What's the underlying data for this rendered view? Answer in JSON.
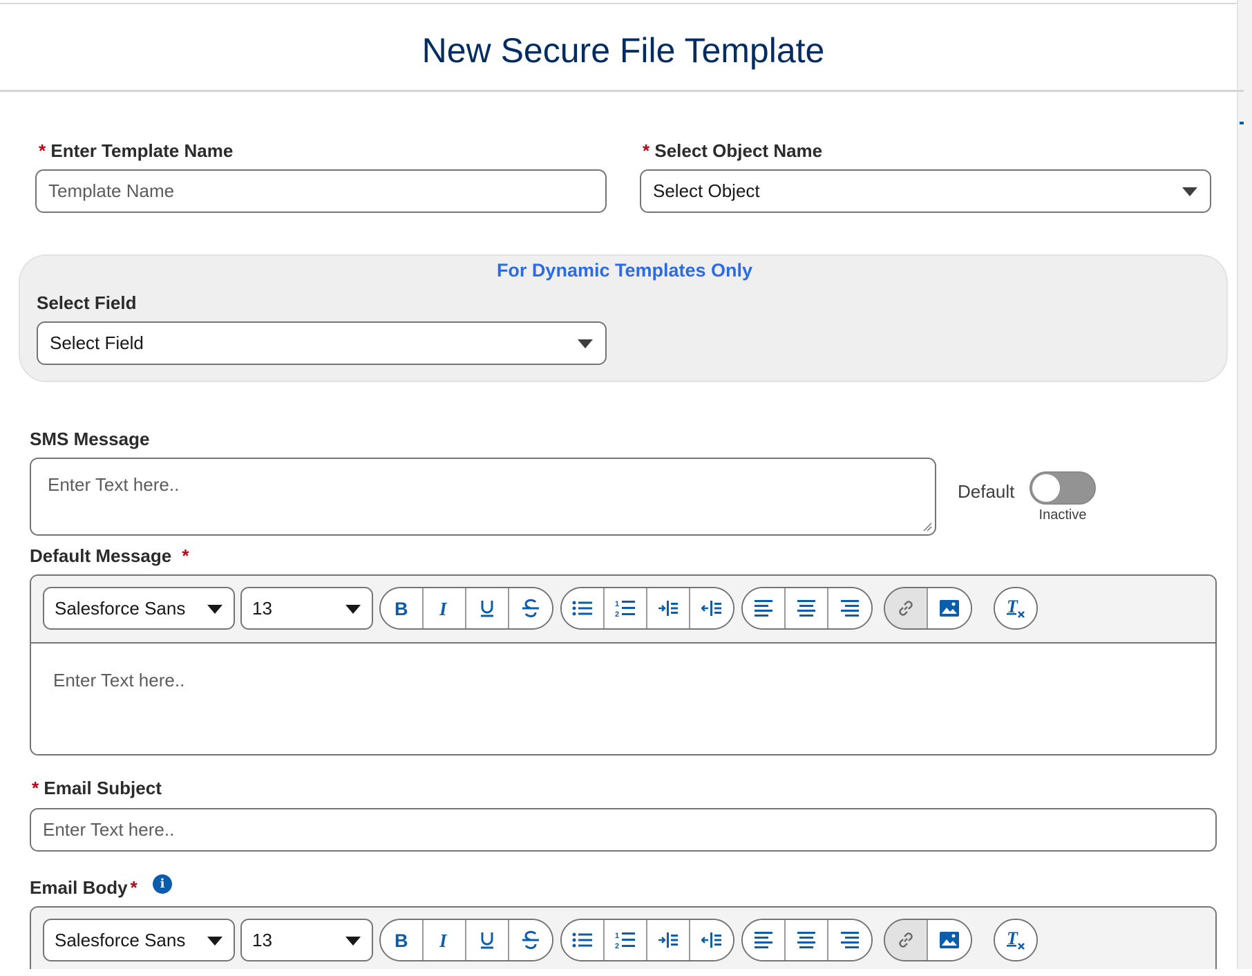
{
  "header": {
    "title": "New Secure File Template"
  },
  "form": {
    "required_mark": "*",
    "template_name": {
      "label": "Enter Template Name",
      "placeholder": "Template Name"
    },
    "object_name": {
      "label": "Select Object Name",
      "selected": "Select Object"
    },
    "dynamic": {
      "title": "For Dynamic Templates Only",
      "field_label": "Select Field",
      "field_selected": "Select Field"
    },
    "sms": {
      "label": "SMS Message",
      "placeholder": "Enter Text here..",
      "toggle_label": "Default",
      "toggle_state": "Inactive"
    },
    "default_message": {
      "label": "Default Message",
      "font": "Salesforce Sans",
      "size": "13",
      "placeholder": "Enter Text here.."
    },
    "email_subject": {
      "label": "Email Subject",
      "placeholder": "Enter Text here.."
    },
    "email_body": {
      "label": "Email Body",
      "info_glyph": "i",
      "font": "Salesforce Sans",
      "size": "13"
    }
  },
  "toolbar_icons": [
    "bold-icon",
    "italic-icon",
    "underline-icon",
    "strikethrough-icon",
    "bullet-list-icon",
    "numbered-list-icon",
    "indent-icon",
    "outdent-icon",
    "align-left-icon",
    "align-center-icon",
    "align-right-icon",
    "link-icon",
    "image-icon",
    "clear-formatting-icon"
  ],
  "colors": {
    "title": "#032d60",
    "required": "#ba0517",
    "dynamic_title": "#2c6be3",
    "icon_blue": "#0b5cab",
    "toggle_off": "#939393"
  }
}
